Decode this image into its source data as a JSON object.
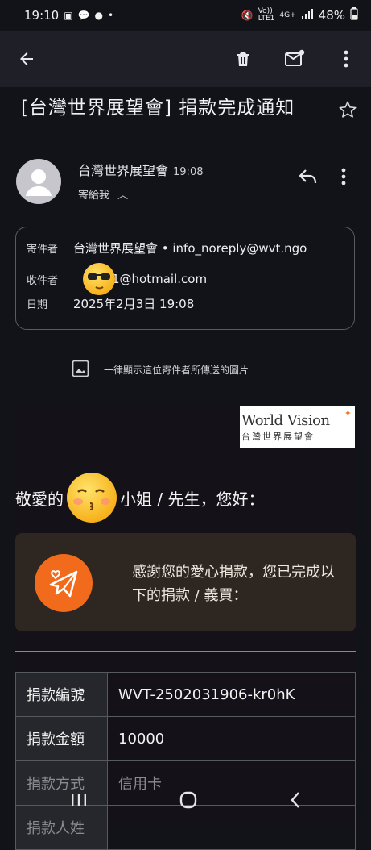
{
  "status_bar": {
    "time": "19:10",
    "network_top": "Vo))",
    "network_bottom": "LTE1",
    "signal_type": "4G+",
    "battery": "48%"
  },
  "app_bar": {
    "icons": [
      "back-arrow-icon",
      "trash-icon",
      "mark-unread-icon",
      "more-vert-icon"
    ]
  },
  "email": {
    "subject": "[台灣世界展望會] 捐款完成通知",
    "sender_name": "台灣世界展望會",
    "time": "19:08",
    "to_summary": "寄給我",
    "details": {
      "from_label": "寄件者",
      "from_value": "台灣世界展望會 • info_noreply@wvt.ngo",
      "to_label": "收件者",
      "to_value": "1@hotmail.com",
      "date_label": "日期",
      "date_value": "2025年2月3日 19:08"
    },
    "images_note": "一律顯示這位寄件者所傳送的圖片"
  },
  "body": {
    "logo_title": "World Vision",
    "logo_subtitle": "台灣世界展望會",
    "greeting_prefix": "敬愛的",
    "greeting_suffix": "小姐 / 先生，您好：",
    "thanks_text": "感謝您的愛心捐款，您已完成以下的捐款 / 義買：",
    "table": [
      {
        "key": "捐款編號",
        "value": "WVT-2502031906-kr0hK"
      },
      {
        "key": "捐款金額",
        "value": "10000"
      },
      {
        "key": "捐款方式",
        "value": "信用卡"
      },
      {
        "key": "捐款人姓",
        "value": ""
      }
    ]
  },
  "colors": {
    "background": "#121219",
    "accent_orange": "#f26a1b",
    "card_brown": "#2e2620"
  }
}
